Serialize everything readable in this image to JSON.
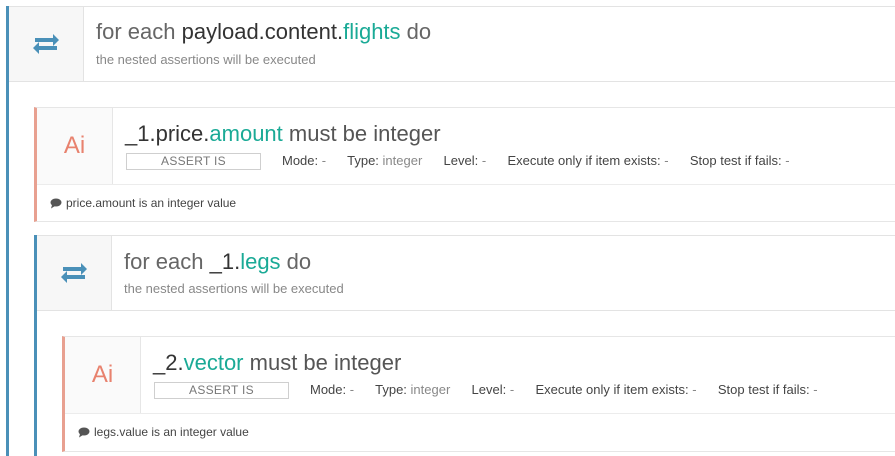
{
  "loop1": {
    "prefix": "for each ",
    "path": "payload.content.",
    "field": "flights",
    "suffix": " do",
    "subtitle": "the nested assertions will be executed",
    "icon": "repeat-icon"
  },
  "assert1": {
    "icon_text": "Ai",
    "path": "_1.price.",
    "field": "amount",
    "rest": " must be integer",
    "badge": "ASSERT IS",
    "mode_label": "Mode:",
    "mode_value": "-",
    "type_label": "Type:",
    "type_value": "integer",
    "level_label": "Level:",
    "level_value": "-",
    "exec_label": "Execute only if item exists:",
    "exec_value": "-",
    "stop_label": "Stop test if fails:",
    "stop_value": "-",
    "comment": "price.amount is an integer value"
  },
  "loop2": {
    "prefix": "for each ",
    "path": "_1.",
    "field": "legs",
    "suffix": " do",
    "subtitle": "the nested assertions will be executed",
    "icon": "repeat-icon"
  },
  "assert2": {
    "icon_text": "Ai",
    "path": "_2.",
    "field": "vector",
    "rest": " must be integer",
    "badge": "ASSERT IS",
    "mode_label": "Mode:",
    "mode_value": "-",
    "type_label": "Type:",
    "type_value": "integer",
    "level_label": "Level:",
    "level_value": "-",
    "exec_label": "Execute only if item exists:",
    "exec_value": "-",
    "stop_label": "Stop test if fails:",
    "stop_value": "-",
    "comment": "legs.value is an integer value"
  },
  "colors": {
    "accent": "#1aaa96",
    "rail": "#4a90b8",
    "assert_border": "#e8a090"
  }
}
